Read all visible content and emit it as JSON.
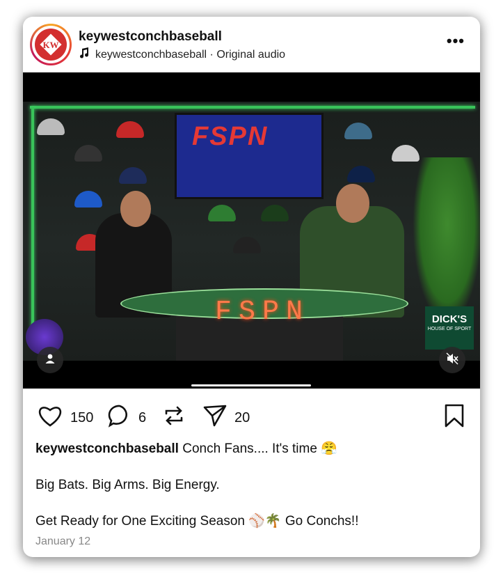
{
  "post": {
    "username": "keywestconchbaseball",
    "audio": "keywestconchbaseball · Original audio",
    "avatar_icon": "kw-baseball-logo-icon",
    "more_label": "•••"
  },
  "media": {
    "tv_text": "FSPN",
    "desk_text": "FSPN",
    "sponsor_text": "DICK'S",
    "sponsor_sub": "HOUSE OF SPORT"
  },
  "actions": {
    "likes": "150",
    "comments": "6",
    "shares": "20"
  },
  "caption": {
    "username": "keywestconchbaseball",
    "line1": "Conch Fans.... It's time 😤",
    "line2": "Big Bats. Big Arms. Big Energy.",
    "line3": "Get Ready for One Exciting Season ⚾🌴 Go Conchs!!",
    "date": "January 12"
  },
  "colors": {
    "accent_red": "#d32f2f",
    "led_green": "#39c35a"
  }
}
